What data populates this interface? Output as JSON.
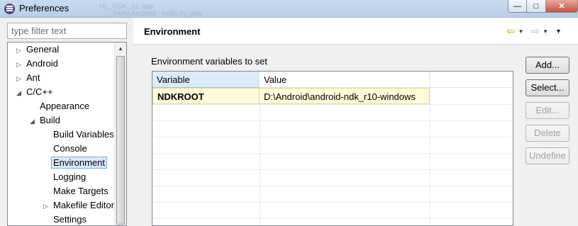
{
  "window": {
    "title": "Preferences",
    "ghost_tabs": [
      "HL_NDK_31.app",
      "Hello Android - HelloJni.java"
    ],
    "controls": {
      "minimize": "—",
      "maximize": "□",
      "close": "✕"
    }
  },
  "sidebar": {
    "filter_placeholder": "type filter text",
    "tree": [
      {
        "label": "General",
        "level": 0,
        "twisty": "collapsed"
      },
      {
        "label": "Android",
        "level": 0,
        "twisty": "collapsed"
      },
      {
        "label": "Ant",
        "level": 0,
        "twisty": "collapsed"
      },
      {
        "label": "C/C++",
        "level": 0,
        "twisty": "expanded"
      },
      {
        "label": "Appearance",
        "level": 1,
        "twisty": "none"
      },
      {
        "label": "Build",
        "level": 1,
        "twisty": "expanded"
      },
      {
        "label": "Build Variables",
        "level": 2,
        "twisty": "none"
      },
      {
        "label": "Console",
        "level": 2,
        "twisty": "none"
      },
      {
        "label": "Environment",
        "level": 2,
        "twisty": "none",
        "selected": true
      },
      {
        "label": "Logging",
        "level": 2,
        "twisty": "none"
      },
      {
        "label": "Make Targets",
        "level": 2,
        "twisty": "none"
      },
      {
        "label": "Makefile Editor",
        "level": 2,
        "twisty": "collapsed"
      },
      {
        "label": "Settings",
        "level": 2,
        "twisty": "none"
      }
    ]
  },
  "main": {
    "title": "Environment",
    "nav": {
      "back_icon": "arrow-left-icon",
      "forward_icon": "arrow-right-icon",
      "menu_icon": "chevron-down-icon"
    },
    "section_label": "Environment variables to set",
    "table": {
      "columns": [
        "Variable",
        "Value"
      ],
      "rows": [
        {
          "variable": "NDKROOT",
          "value": "D:\\Android\\android-ndk_r10-windows"
        }
      ]
    },
    "buttons": [
      {
        "label": "Add...",
        "enabled": true
      },
      {
        "label": "Select...",
        "enabled": true
      },
      {
        "label": "Edit...",
        "enabled": false
      },
      {
        "label": "Delete",
        "enabled": false
      },
      {
        "label": "Undefine",
        "enabled": false
      }
    ]
  },
  "colors": {
    "selection": "#d9e8fb",
    "row_highlight": "#fffad9",
    "back_arrow": "#d59a2a"
  }
}
